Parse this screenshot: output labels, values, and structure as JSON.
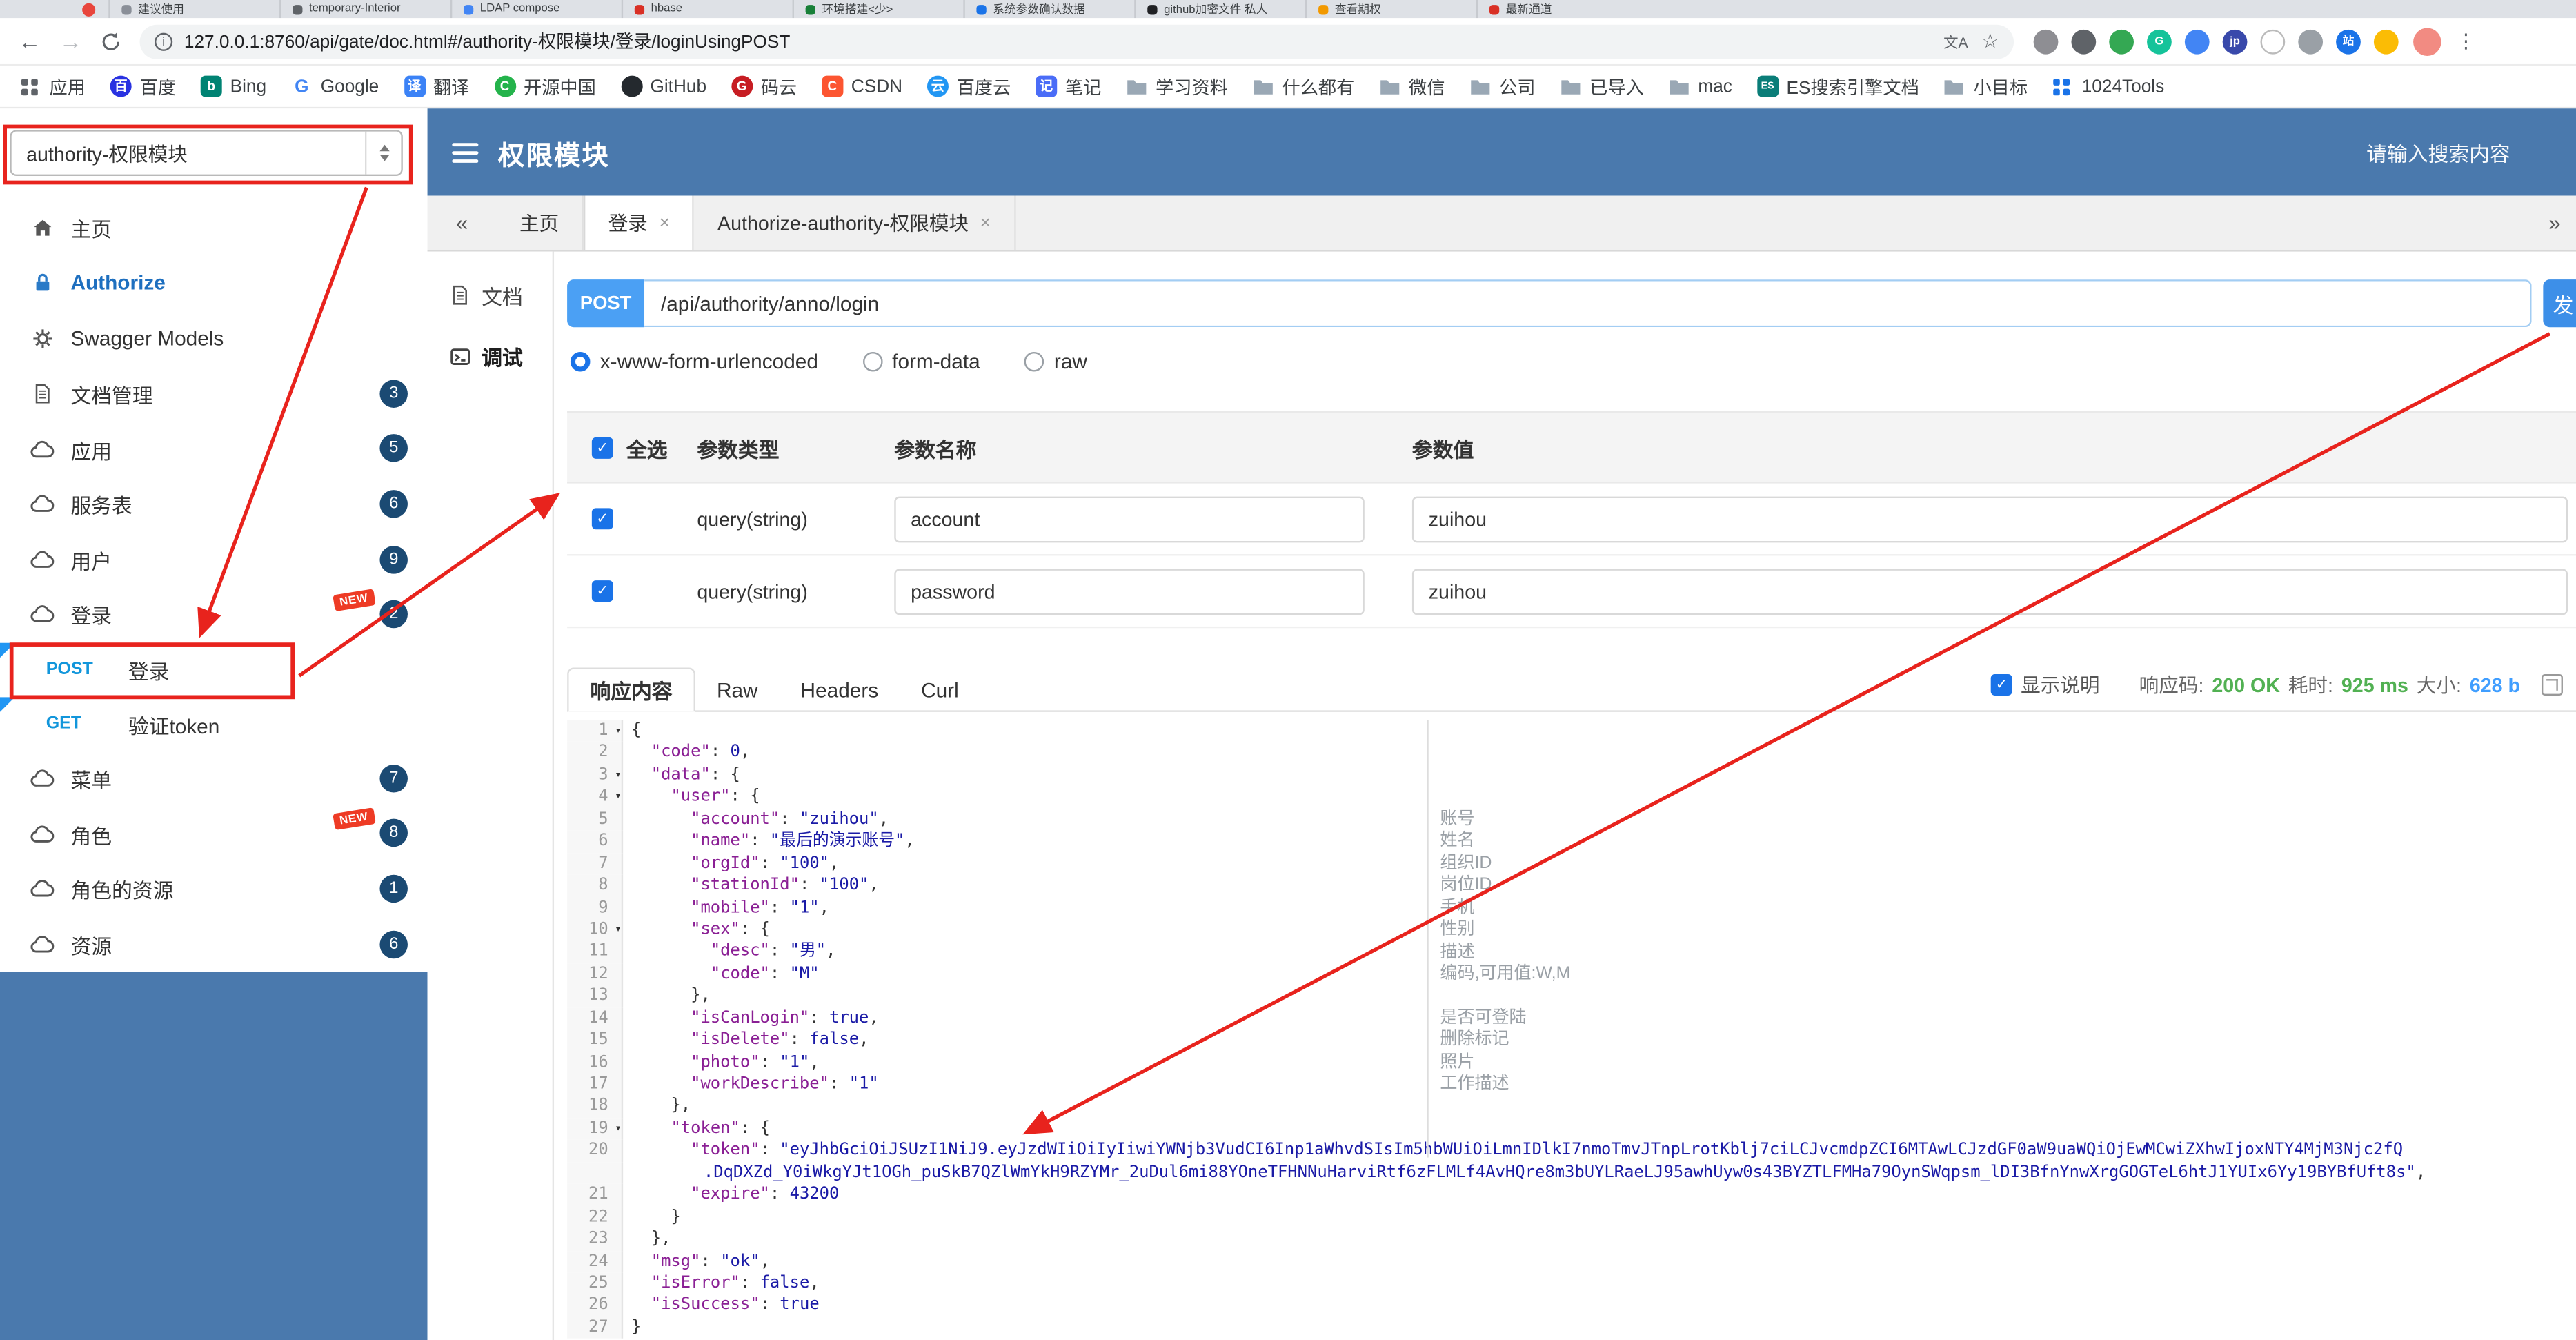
{
  "browser": {
    "tabs": [
      {
        "title": "建议使用",
        "color": "#8a8f98"
      },
      {
        "title": "temporary-Interior",
        "color": "#5f6368"
      },
      {
        "title": "LDAP compose",
        "color": "#4285f4"
      },
      {
        "title": "hbase",
        "color": "#d93025"
      },
      {
        "title": "环境搭建<少>",
        "color": "#188038"
      },
      {
        "title": "系统参数确认数据",
        "color": "#1a73e8"
      },
      {
        "title": "github加密文件 私人",
        "color": "#202124"
      },
      {
        "title": "查看期权",
        "color": "#f29900"
      },
      {
        "title": "最新通道",
        "color": "#d93025"
      }
    ],
    "url": "127.0.0.1:8760/api/gate/doc.html#/authority-权限模块/登录/loginUsingPOST",
    "bookmarks": [
      {
        "label": "应用",
        "icon": "apps"
      },
      {
        "label": "百度",
        "icon": "baidu"
      },
      {
        "label": "Bing",
        "icon": "bing"
      },
      {
        "label": "Google",
        "icon": "google"
      },
      {
        "label": "翻译",
        "icon": "translate"
      },
      {
        "label": "开源中国",
        "icon": "oschina"
      },
      {
        "label": "GitHub",
        "icon": "github"
      },
      {
        "label": "码云",
        "icon": "gitee"
      },
      {
        "label": "CSDN",
        "icon": "csdn"
      },
      {
        "label": "百度云",
        "icon": "cloud"
      },
      {
        "label": "笔记",
        "icon": "note"
      },
      {
        "label": "学习资料",
        "icon": "folder"
      },
      {
        "label": "什么都有",
        "icon": "folder"
      },
      {
        "label": "微信",
        "icon": "folder"
      },
      {
        "label": "公司",
        "icon": "folder"
      },
      {
        "label": "已导入",
        "icon": "folder"
      },
      {
        "label": "mac",
        "icon": "folder"
      },
      {
        "label": "ES搜索引擎文档",
        "icon": "es"
      },
      {
        "label": "小目标",
        "icon": "folder"
      },
      {
        "label": "1024Tools",
        "icon": "tools"
      }
    ],
    "extensions": [
      {
        "bg": "#8e8e93",
        "ch": ""
      },
      {
        "bg": "#5f6368",
        "ch": ""
      },
      {
        "bg": "#34a853",
        "ch": ""
      },
      {
        "bg": "#15c39a",
        "ch": "G"
      },
      {
        "bg": "#4285f4",
        "ch": ""
      },
      {
        "bg": "#3949ab",
        "ch": "jp"
      },
      {
        "bg": "#ffffff",
        "ch": "",
        "border": true
      },
      {
        "bg": "#9aa0a6",
        "ch": ""
      },
      {
        "bg": "#1a73e8",
        "ch": "站"
      },
      {
        "bg": "#fbbc05",
        "ch": ""
      }
    ]
  },
  "header": {
    "module_select": "authority-权限模块",
    "title": "权限模块",
    "search_placeholder": "请输入搜索内容"
  },
  "sidebar": {
    "items": [
      {
        "label": "主页",
        "icon": "home"
      },
      {
        "label": "Authorize",
        "icon": "lock",
        "authorize": true
      },
      {
        "label": "Swagger Models",
        "icon": "gear"
      },
      {
        "label": "文档管理",
        "icon": "doc",
        "badge": "3"
      },
      {
        "label": "应用",
        "icon": "cloud",
        "badge": "5"
      },
      {
        "label": "服务表",
        "icon": "cloud",
        "badge": "6"
      },
      {
        "label": "用户",
        "icon": "cloud",
        "badge": "9"
      },
      {
        "label": "登录",
        "icon": "cloud",
        "badge": "2",
        "is_new": true
      },
      {
        "method": "POST",
        "label": "登录",
        "highlighted": true
      },
      {
        "method": "GET",
        "label": "验证token"
      },
      {
        "label": "菜单",
        "icon": "cloud",
        "badge": "7"
      },
      {
        "label": "角色",
        "icon": "cloud",
        "badge": "8",
        "is_new": true
      },
      {
        "label": "角色的资源",
        "icon": "cloud",
        "badge": "1"
      },
      {
        "label": "资源",
        "icon": "cloud",
        "badge": "6"
      }
    ]
  },
  "content_tabs": [
    {
      "label": "主页",
      "closable": false,
      "active": false
    },
    {
      "label": "登录",
      "closable": true,
      "active": true
    },
    {
      "label": "Authorize-authority-权限模块",
      "closable": true,
      "active": false
    }
  ],
  "doc_nav": [
    {
      "label": "文档",
      "icon": "doc",
      "active": false
    },
    {
      "label": "调试",
      "icon": "debug",
      "active": true
    }
  ],
  "request": {
    "method": "POST",
    "path": "/api/authority/anno/login",
    "send_label": "发",
    "body_types": [
      "x-www-form-urlencoded",
      "form-data",
      "raw"
    ],
    "selected_body_type": "x-www-form-urlencoded"
  },
  "params": {
    "select_all": true,
    "select_all_label": "全选",
    "col_type": "参数类型",
    "col_name": "参数名称",
    "col_value": "参数值",
    "rows": [
      {
        "checked": true,
        "type": "query(string)",
        "name": "account",
        "value": "zuihou"
      },
      {
        "checked": true,
        "type": "query(string)",
        "name": "password",
        "value": "zuihou"
      }
    ]
  },
  "response": {
    "tabs": [
      "响应内容",
      "Raw",
      "Headers",
      "Curl"
    ],
    "active_tab": "响应内容",
    "show_desc_label": "显示说明",
    "show_desc_checked": true,
    "status_label": "响应码:",
    "status_value": "200 OK",
    "time_label": "耗时:",
    "time_value": "925 ms",
    "size_label": "大小:",
    "size_value": "628 b"
  },
  "code": {
    "lines": [
      {
        "n": 1,
        "fold": true,
        "parts": [
          [
            "p",
            "{"
          ]
        ]
      },
      {
        "n": 2,
        "parts": [
          [
            "p",
            "  "
          ],
          [
            "k",
            "\"code\""
          ],
          [
            "p",
            ": "
          ],
          [
            "n",
            "0"
          ],
          [
            "p",
            ","
          ]
        ]
      },
      {
        "n": 3,
        "fold": true,
        "parts": [
          [
            "p",
            "  "
          ],
          [
            "k",
            "\"data\""
          ],
          [
            "p",
            ": {"
          ]
        ]
      },
      {
        "n": 4,
        "fold": true,
        "parts": [
          [
            "p",
            "    "
          ],
          [
            "k",
            "\"user\""
          ],
          [
            "p",
            ": {"
          ]
        ]
      },
      {
        "n": 5,
        "parts": [
          [
            "p",
            "      "
          ],
          [
            "k",
            "\"account\""
          ],
          [
            "p",
            ": "
          ],
          [
            "s",
            "\"zuihou\""
          ],
          [
            "p",
            ","
          ]
        ]
      },
      {
        "n": 6,
        "parts": [
          [
            "p",
            "      "
          ],
          [
            "k",
            "\"name\""
          ],
          [
            "p",
            ": "
          ],
          [
            "s",
            "\"最后的演示账号\""
          ],
          [
            "p",
            ","
          ]
        ]
      },
      {
        "n": 7,
        "parts": [
          [
            "p",
            "      "
          ],
          [
            "k",
            "\"orgId\""
          ],
          [
            "p",
            ": "
          ],
          [
            "s",
            "\"100\""
          ],
          [
            "p",
            ","
          ]
        ]
      },
      {
        "n": 8,
        "parts": [
          [
            "p",
            "      "
          ],
          [
            "k",
            "\"stationId\""
          ],
          [
            "p",
            ": "
          ],
          [
            "s",
            "\"100\""
          ],
          [
            "p",
            ","
          ]
        ]
      },
      {
        "n": 9,
        "parts": [
          [
            "p",
            "      "
          ],
          [
            "k",
            "\"mobile\""
          ],
          [
            "p",
            ": "
          ],
          [
            "s",
            "\"1\""
          ],
          [
            "p",
            ","
          ]
        ]
      },
      {
        "n": 10,
        "fold": true,
        "parts": [
          [
            "p",
            "      "
          ],
          [
            "k",
            "\"sex\""
          ],
          [
            "p",
            ": {"
          ]
        ]
      },
      {
        "n": 11,
        "parts": [
          [
            "p",
            "        "
          ],
          [
            "k",
            "\"desc\""
          ],
          [
            "p",
            ": "
          ],
          [
            "s",
            "\"男\""
          ],
          [
            "p",
            ","
          ]
        ]
      },
      {
        "n": 12,
        "parts": [
          [
            "p",
            "        "
          ],
          [
            "k",
            "\"code\""
          ],
          [
            "p",
            ": "
          ],
          [
            "s",
            "\"M\""
          ]
        ]
      },
      {
        "n": 13,
        "parts": [
          [
            "p",
            "      },"
          ]
        ]
      },
      {
        "n": 14,
        "parts": [
          [
            "p",
            "      "
          ],
          [
            "k",
            "\"isCanLogin\""
          ],
          [
            "p",
            ": "
          ],
          [
            "b",
            "true"
          ],
          [
            "p",
            ","
          ]
        ]
      },
      {
        "n": 15,
        "parts": [
          [
            "p",
            "      "
          ],
          [
            "k",
            "\"isDelete\""
          ],
          [
            "p",
            ": "
          ],
          [
            "b",
            "false"
          ],
          [
            "p",
            ","
          ]
        ]
      },
      {
        "n": 16,
        "parts": [
          [
            "p",
            "      "
          ],
          [
            "k",
            "\"photo\""
          ],
          [
            "p",
            ": "
          ],
          [
            "s",
            "\"1\""
          ],
          [
            "p",
            ","
          ]
        ]
      },
      {
        "n": 17,
        "parts": [
          [
            "p",
            "      "
          ],
          [
            "k",
            "\"workDescribe\""
          ],
          [
            "p",
            ": "
          ],
          [
            "s",
            "\"1\""
          ]
        ]
      },
      {
        "n": 18,
        "parts": [
          [
            "p",
            "    },"
          ]
        ]
      },
      {
        "n": 19,
        "fold": true,
        "parts": [
          [
            "p",
            "    "
          ],
          [
            "k",
            "\"token\""
          ],
          [
            "p",
            ": {"
          ]
        ]
      },
      {
        "n": 20,
        "parts": [
          [
            "p",
            "      "
          ],
          [
            "k",
            "\"token\""
          ],
          [
            "p",
            ": "
          ],
          [
            "s",
            "\"eyJhbGciOiJSUzI1NiJ9.eyJzdWIiOiIyIiwiYWNjb3VudCI6Inp1aWhvdSIsIm5hbWUiOiLmnIDlkI7nmoTmvJTnpLrotKblj7ciLCJvcmdpZCI6MTAwLCJzdGF0aW9uaWQiOjEwMCwiZXhwIjoxNTY4MjM3Njc2fQ"
          ]
        ],
        "wrap": [
          [
            "s",
            ".DqDXZd_Y0iWkgYJt1OGh_puSkB7QZlWmYkH9RZYMr_2uDul6mi88YOneTFHNNuHarviRtf6zFLMLf4AvHQre8m3bUYLRaeLJ95awhUyw0s43BYZTLFMHa79OynSWqpsm_lDI3BfnYnwXrgGOGTeL6htJ1YUIx6Yy19BYBfUft8s\""
          ],
          [
            "p",
            ","
          ]
        ]
      },
      {
        "n": 21,
        "parts": [
          [
            "p",
            "      "
          ],
          [
            "k",
            "\"expire\""
          ],
          [
            "p",
            ": "
          ],
          [
            "n",
            "43200"
          ]
        ]
      },
      {
        "n": 22,
        "parts": [
          [
            "p",
            "    }"
          ]
        ]
      },
      {
        "n": 23,
        "parts": [
          [
            "p",
            "  },"
          ]
        ]
      },
      {
        "n": 24,
        "parts": [
          [
            "p",
            "  "
          ],
          [
            "k",
            "\"msg\""
          ],
          [
            "p",
            ": "
          ],
          [
            "s",
            "\"ok\""
          ],
          [
            "p",
            ","
          ]
        ]
      },
      {
        "n": 25,
        "parts": [
          [
            "p",
            "  "
          ],
          [
            "k",
            "\"isError\""
          ],
          [
            "p",
            ": "
          ],
          [
            "b",
            "false"
          ],
          [
            "p",
            ","
          ]
        ]
      },
      {
        "n": 26,
        "parts": [
          [
            "p",
            "  "
          ],
          [
            "k",
            "\"isSuccess\""
          ],
          [
            "p",
            ": "
          ],
          [
            "b",
            "true"
          ]
        ]
      },
      {
        "n": 27,
        "parts": [
          [
            "p",
            "}"
          ]
        ]
      }
    ],
    "annotations": [
      {
        "row": 4,
        "text": "账号"
      },
      {
        "row": 5,
        "text": "姓名"
      },
      {
        "row": 6,
        "text": "组织ID"
      },
      {
        "row": 7,
        "text": "岗位ID"
      },
      {
        "row": 8,
        "text": "手机"
      },
      {
        "row": 9,
        "text": "性别"
      },
      {
        "row": 10,
        "text": "描述"
      },
      {
        "row": 11,
        "text": "编码,可用值:W,M"
      },
      {
        "row": 13,
        "text": "是否可登陆"
      },
      {
        "row": 14,
        "text": "删除标记"
      },
      {
        "row": 15,
        "text": "照片"
      },
      {
        "row": 16,
        "text": "工作描述"
      }
    ]
  },
  "colors": {
    "theme_blue": "#4a79ad",
    "method_blue": "#1296db",
    "success_green": "#52b153",
    "link_blue": "#409eff",
    "annotation_red": "#e8231d"
  }
}
